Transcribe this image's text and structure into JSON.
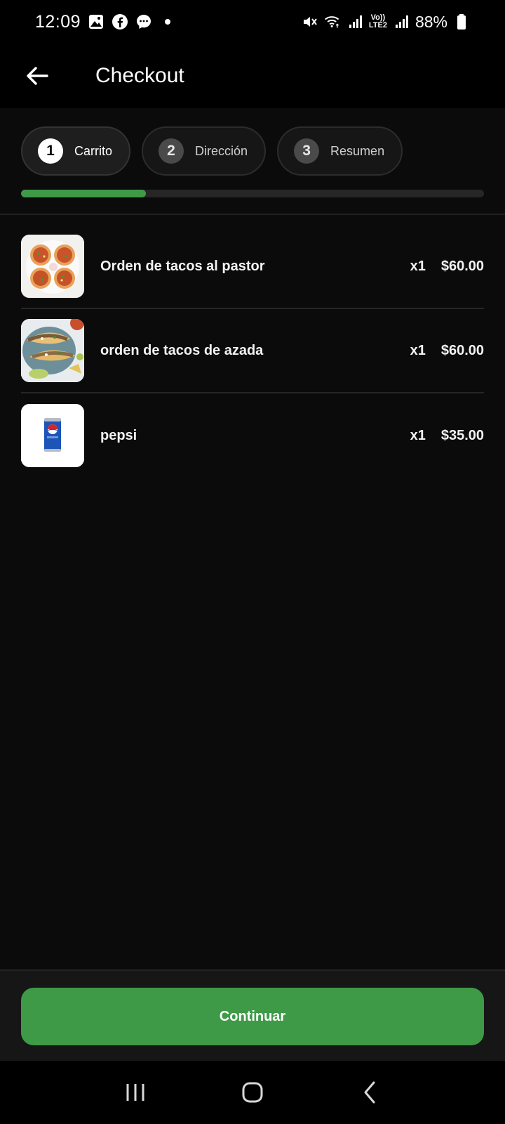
{
  "status_bar": {
    "time": "12:09",
    "battery": "88%",
    "left_icons": [
      "gallery-icon",
      "facebook-icon",
      "messenger-icon",
      "dot-icon"
    ],
    "right_icons": [
      "mute-icon",
      "wifi-icon",
      "signal-icon",
      "volte-icon",
      "signal-icon-2",
      "battery-icon"
    ],
    "volte_label_top": "Vo))",
    "volte_label_bottom": "LTE2"
  },
  "app_bar": {
    "title": "Checkout",
    "back_icon": "arrow-left-icon"
  },
  "steps": [
    {
      "number": "1",
      "label": "Carrito",
      "active": true
    },
    {
      "number": "2",
      "label": "Dirección",
      "active": false
    },
    {
      "number": "3",
      "label": "Resumen",
      "active": false
    }
  ],
  "progress": {
    "value": 0.27,
    "color": "#3f9a48"
  },
  "cart": {
    "items": [
      {
        "name": "Orden de tacos al pastor",
        "qty": "x1",
        "price": "$60.00",
        "image": "tacos-al-pastor-image"
      },
      {
        "name": "orden de tacos de azada",
        "qty": "x1",
        "price": "$60.00",
        "image": "tacos-de-azada-image"
      },
      {
        "name": "pepsi",
        "qty": "x1",
        "price": "$35.00",
        "image": "pepsi-can-image"
      }
    ]
  },
  "actions": {
    "continue_label": "Continuar"
  },
  "colors": {
    "accent": "#3f9a48",
    "background": "#0b0b0b"
  },
  "nav_bar": {
    "icons": [
      "recent-apps-icon",
      "home-icon",
      "back-icon"
    ]
  }
}
